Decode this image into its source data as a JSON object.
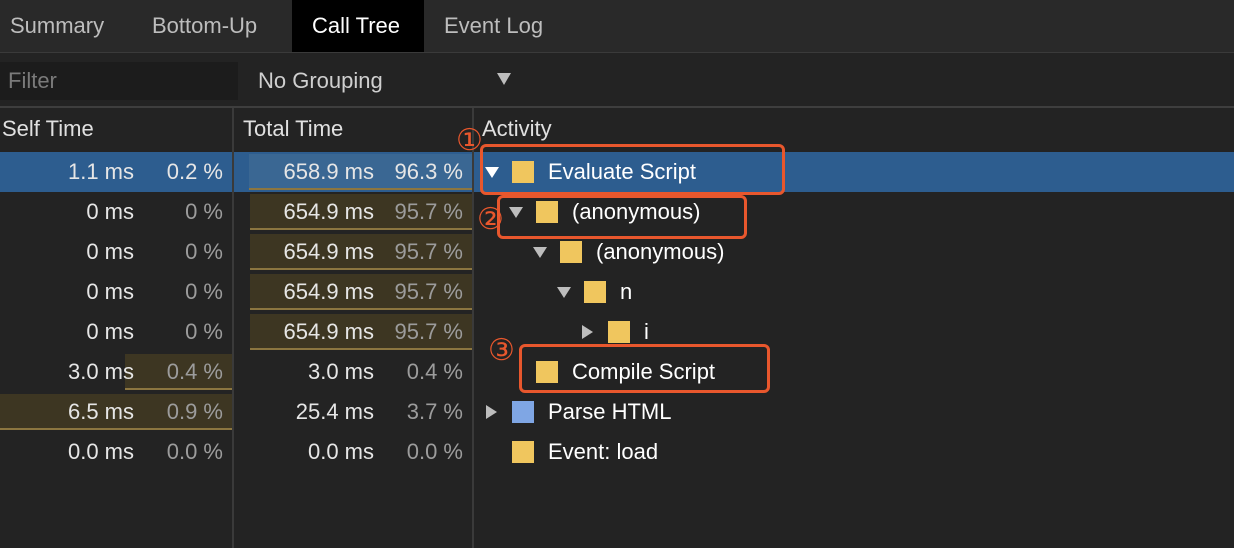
{
  "tabs": [
    {
      "label": "Summary",
      "active": false
    },
    {
      "label": "Bottom-Up",
      "active": false
    },
    {
      "label": "Call Tree",
      "active": true
    },
    {
      "label": "Event Log",
      "active": false
    }
  ],
  "toolbar": {
    "filter_placeholder": "Filter",
    "grouping_value": "No Grouping"
  },
  "columns": {
    "self_time": "Self Time",
    "total_time": "Total Time",
    "activity": "Activity"
  },
  "rows": [
    {
      "self_ms": "1.1 ms",
      "self_pct": "0.2 %",
      "total_ms": "658.9 ms",
      "total_pct": "96.3 %",
      "activity": "Evaluate Script",
      "expander": "down",
      "color": "#f0c65e",
      "selected": true,
      "self_share": 0.002,
      "total_share": 0.963
    },
    {
      "self_ms": "0 ms",
      "self_pct": "0 %",
      "total_ms": "654.9 ms",
      "total_pct": "95.7 %",
      "activity": "(anonymous)",
      "expander": "down",
      "color": "#f0c65e",
      "selected": false,
      "self_share": 0,
      "total_share": 0.957
    },
    {
      "self_ms": "0 ms",
      "self_pct": "0 %",
      "total_ms": "654.9 ms",
      "total_pct": "95.7 %",
      "activity": "(anonymous)",
      "expander": "down",
      "color": "#f0c65e",
      "selected": false,
      "self_share": 0,
      "total_share": 0.957
    },
    {
      "self_ms": "0 ms",
      "self_pct": "0 %",
      "total_ms": "654.9 ms",
      "total_pct": "95.7 %",
      "activity": "n",
      "expander": "down",
      "color": "#f0c65e",
      "selected": false,
      "self_share": 0,
      "total_share": 0.957
    },
    {
      "self_ms": "0 ms",
      "self_pct": "0 %",
      "total_ms": "654.9 ms",
      "total_pct": "95.7 %",
      "activity": "i",
      "expander": "right",
      "color": "#f0c65e",
      "selected": false,
      "self_share": 0,
      "total_share": 0.957
    },
    {
      "self_ms": "3.0 ms",
      "self_pct": "0.4 %",
      "total_ms": "3.0 ms",
      "total_pct": "0.4 %",
      "activity": "Compile Script",
      "expander": "none",
      "color": "#f0c65e",
      "selected": false,
      "self_share": 0.46,
      "total_share": 0
    },
    {
      "self_ms": "6.5 ms",
      "self_pct": "0.9 %",
      "total_ms": "25.4 ms",
      "total_pct": "3.7 %",
      "activity": "Parse HTML",
      "expander": "right",
      "color": "#7fa6e4",
      "selected": false,
      "self_share": 1.0,
      "total_share": 0
    },
    {
      "self_ms": "0.0 ms",
      "self_pct": "0.0 %",
      "total_ms": "0.0 ms",
      "total_pct": "0.0 %",
      "activity": "Event: load",
      "expander": "none",
      "color": "#f0c65e",
      "selected": false,
      "self_share": 0,
      "total_share": 0
    }
  ],
  "annotations": [
    {
      "number": "①"
    },
    {
      "number": "②"
    },
    {
      "number": "③"
    }
  ]
}
